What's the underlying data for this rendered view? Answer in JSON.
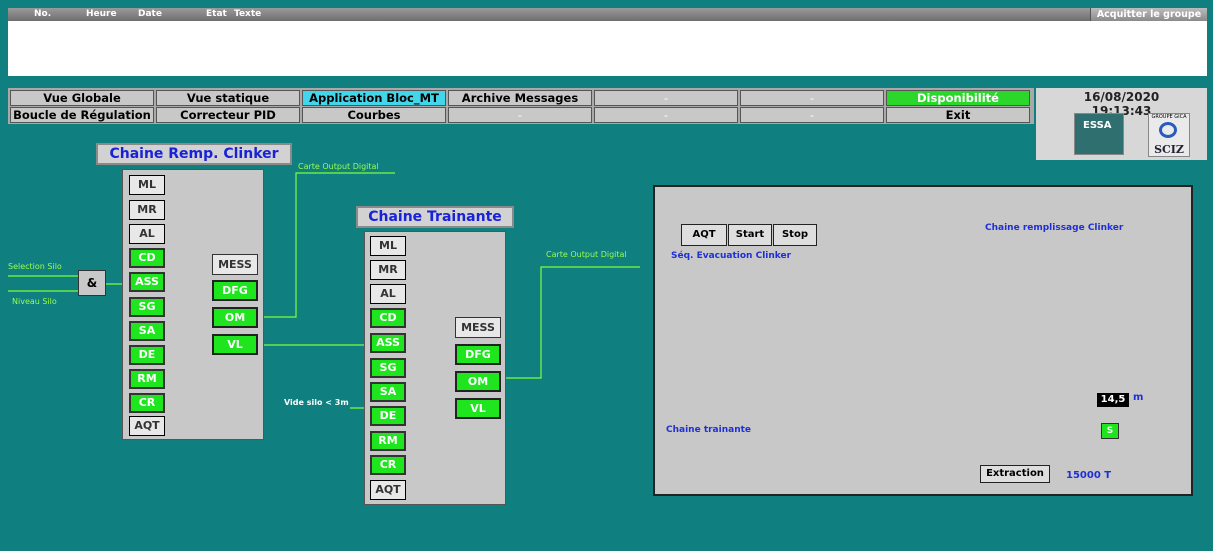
{
  "alarm": {
    "columns": [
      "No.",
      "Heure",
      "Date",
      "Etat",
      "Texte"
    ],
    "ack_label": "Acquitter le groupe"
  },
  "nav": {
    "row1": [
      "Vue Globale",
      "Vue statique",
      "Application Bloc_MT",
      "Archive Messages",
      "-",
      "-",
      "Disponibilité"
    ],
    "row2": [
      "Boucle de Régulation",
      "Correcteur PID",
      "Courbes",
      "-",
      "-",
      "-",
      "Exit"
    ]
  },
  "clock": {
    "date": "16/08/2020",
    "time": "19:13:43"
  },
  "logos": {
    "essa": "ESSA",
    "gica": "GROUPE GICA",
    "sciz": "SCIZ"
  },
  "chain1": {
    "title": "Chaine Remp. Clinker",
    "buttons": [
      "ML",
      "MR",
      "AL",
      "CD",
      "ASS",
      "SG",
      "SA",
      "DE",
      "RM",
      "CR",
      "AQT"
    ],
    "outputs": [
      "MESS",
      "DFG",
      "OM",
      "VL"
    ],
    "and_label": "&",
    "in1": "Selection Silo",
    "in2": "Niveau Silo",
    "out_label": "Carte Output Digital"
  },
  "chain2": {
    "title": "Chaine Trainante",
    "buttons": [
      "ML",
      "MR",
      "AL",
      "CD",
      "ASS",
      "SG",
      "SA",
      "DE",
      "RM",
      "CR",
      "AQT"
    ],
    "outputs": [
      "MESS",
      "DFG",
      "OM",
      "VL"
    ],
    "in_label": "Vide silo < 3m",
    "out_label": "Carte Output Digital"
  },
  "sequence": {
    "buttons": [
      "AQT",
      "Start",
      "Stop"
    ],
    "label": "Séq. Evacuation Clinker",
    "chain_fill": "Chaine remplissage Clinker",
    "chain_drag": "Chaine trainante",
    "level": "14,5",
    "unit": "m",
    "s_label": "S",
    "extraction": "Extraction",
    "capacity": "15000 T"
  },
  "colors": {
    "background": "#0f7f7f",
    "active": "#1ee51e",
    "highlight": "#43d6ea",
    "label_blue": "#1f2fd8"
  }
}
